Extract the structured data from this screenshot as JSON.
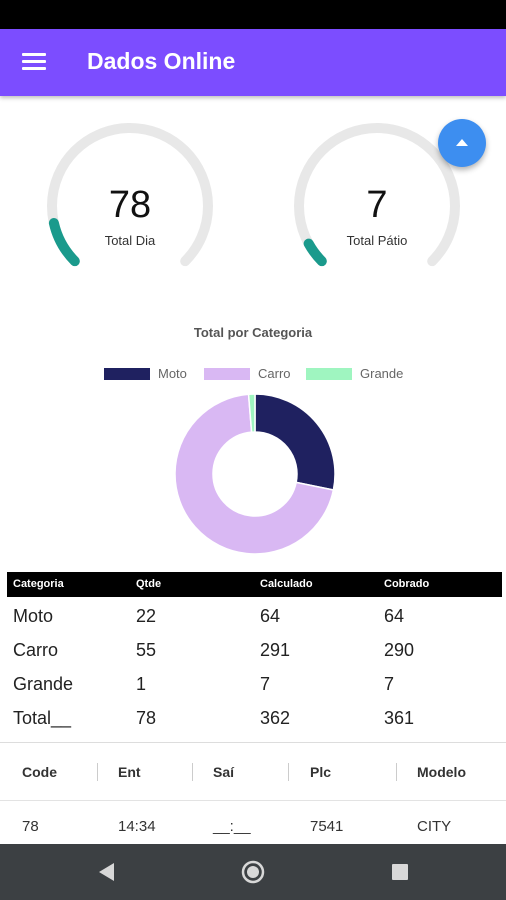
{
  "app": {
    "title": "Dados Online"
  },
  "icons": {
    "menu": "menu-icon",
    "fab": "chevron-up-icon",
    "back": "back-triangle-icon",
    "home": "home-circle-icon",
    "recents": "recents-square-icon"
  },
  "colors": {
    "app_bar": "#7c4dff",
    "gauge_track": "#e8e8e8",
    "gauge_fill": "#1a9a8c",
    "fab": "#3d8ef0",
    "moto": "#1f2160",
    "carro": "#d9b8f3",
    "grande": "#9ff5c0",
    "nav_bar": "#3c4043"
  },
  "gauges": [
    {
      "value": "78",
      "label": "Total Dia",
      "fill_fraction": 0.12
    },
    {
      "value": "7",
      "label": "Total Pátio",
      "fill_fraction": 0.06
    }
  ],
  "chart_data": {
    "type": "pie",
    "title": "Total por Categoria",
    "legend_position": "top",
    "categories": [
      "Moto",
      "Carro",
      "Grande"
    ],
    "values": [
      22,
      55,
      1
    ]
  },
  "category_table": {
    "headers": [
      "Categoria",
      "Qtde",
      "Calculado",
      "Cobrado"
    ],
    "rows": [
      [
        "Moto",
        "22",
        "64",
        "64"
      ],
      [
        "Carro",
        "55",
        "291",
        "290"
      ],
      [
        "Grande",
        "1",
        "7",
        "7"
      ],
      [
        "Total__",
        "78",
        "362",
        "361"
      ]
    ]
  },
  "movements_table": {
    "headers": [
      "Code",
      "Ent",
      "Saí",
      "Plc",
      "Modelo"
    ],
    "rows": [
      [
        "78",
        "14:34",
        "__:__",
        "7541",
        "CITY"
      ]
    ]
  }
}
